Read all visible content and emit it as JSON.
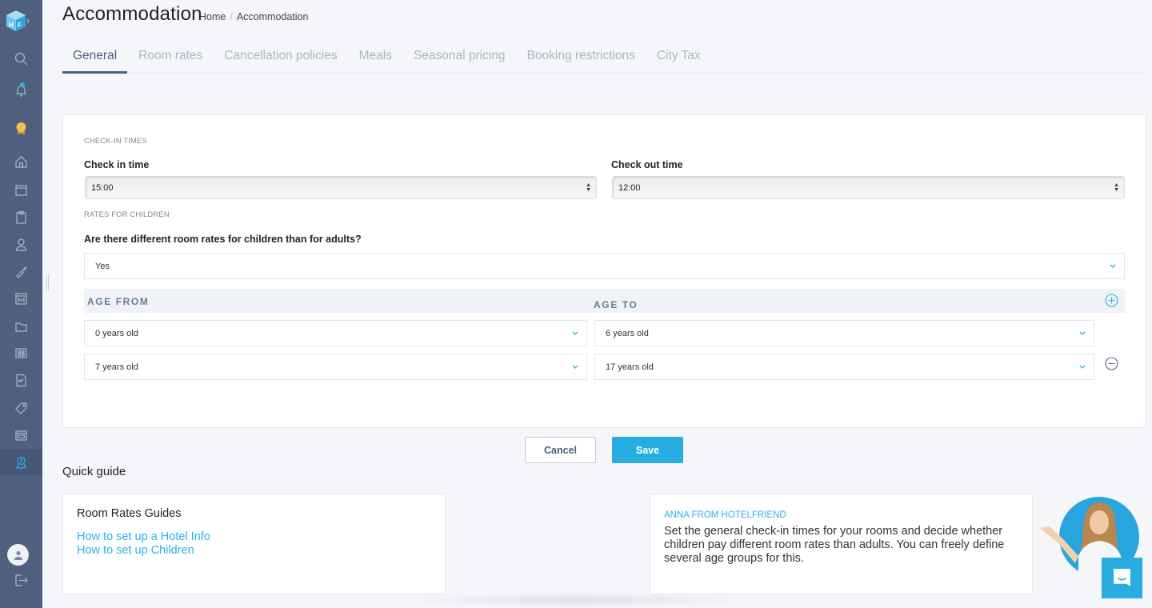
{
  "app": {
    "logo_text": "HF",
    "accent_color": "#28ade3",
    "sidebar_color": "#4f5f7e"
  },
  "sidebar": {
    "items": [
      {
        "icon": "search-icon"
      },
      {
        "icon": "bell-icon",
        "has_notification": true
      },
      {
        "icon": "award-badge-icon"
      },
      {
        "icon": "home-icon"
      },
      {
        "icon": "calendar-icon"
      },
      {
        "icon": "clipboard-icon"
      },
      {
        "icon": "user-icon"
      },
      {
        "icon": "brush-icon"
      },
      {
        "icon": "hotel-building-icon"
      },
      {
        "icon": "folder-icon"
      },
      {
        "icon": "grid-icon"
      },
      {
        "icon": "document-chart-icon"
      },
      {
        "icon": "price-tag-icon"
      },
      {
        "icon": "card-window-icon"
      },
      {
        "icon": "money-certificate-icon",
        "active": true
      }
    ],
    "bottom": [
      {
        "icon": "avatar-icon"
      },
      {
        "icon": "logout-icon"
      }
    ]
  },
  "header": {
    "title": "Accommodation",
    "breadcrumb": [
      "Home",
      "Accommodation"
    ],
    "breadcrumb_separator": "/"
  },
  "tabs": [
    {
      "label": "General",
      "active": true
    },
    {
      "label": "Room rates"
    },
    {
      "label": "Cancellation policies"
    },
    {
      "label": "Meals"
    },
    {
      "label": "Seasonal pricing"
    },
    {
      "label": "Booking restrictions"
    },
    {
      "label": "City Tax"
    }
  ],
  "form": {
    "checkin_section": "CHECK-IN TIMES",
    "checkin_label": "Check in time",
    "checkin_value": "15:00",
    "checkout_label": "Check out time",
    "checkout_value": "12:00",
    "children_section": "RATES FOR CHILDREN",
    "children_question": "Are there different room rates for children than for adults?",
    "children_answer": "Yes",
    "age_from_header": "AGE FROM",
    "age_to_header": "AGE TO",
    "age_groups": [
      {
        "from": "0 years old",
        "to": "6 years old"
      },
      {
        "from": "7 years old",
        "to": "17 years old"
      }
    ]
  },
  "actions": {
    "cancel_label": "Cancel",
    "save_label": "Save"
  },
  "quick_guide": {
    "title": "Quick guide",
    "guides_title": "Room Rates Guides",
    "links": [
      "How to set up a Hotel Info",
      "How to set up Children"
    ],
    "assistant_name": "ANNA FROM HOTELFRIEND",
    "assistant_text": "Set the general check-in times for your rooms and decide whether children pay different room rates than adults. You can freely define several age groups for this."
  }
}
